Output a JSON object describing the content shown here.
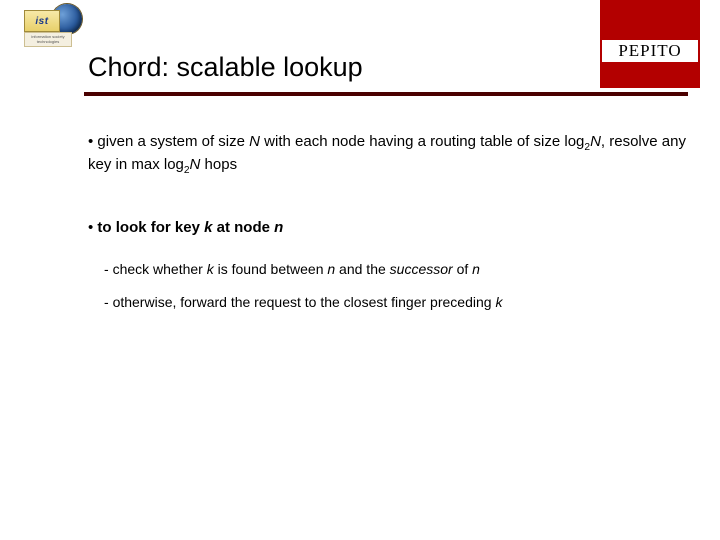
{
  "brand": {
    "label": "PEPITO",
    "logo_text": "ist",
    "logo_caption1": "information society",
    "logo_caption2": "technologies"
  },
  "title": "Chord: scalable lookup",
  "bullets": {
    "b1": {
      "pre": "given a system of size ",
      "N1": "N",
      "mid1": " with each node having a routing table of size log",
      "sub1": "2",
      "N2": "N",
      "mid2": ", resolve any key in max log",
      "sub2": "2",
      "N3": "N",
      "tail": " hops"
    },
    "b2": {
      "pre": "to look for key ",
      "k": "k",
      "mid": " at node ",
      "n": "n"
    }
  },
  "sub": {
    "s1": {
      "pre": "check whether ",
      "k": "k",
      "mid1": " is found between ",
      "n": "n",
      "mid2": " and the ",
      "succ": "successor",
      "mid3": " of ",
      "n2": "n"
    },
    "s2": {
      "pre": "otherwise, forward the request to the closest finger preceding ",
      "k": "k"
    }
  }
}
